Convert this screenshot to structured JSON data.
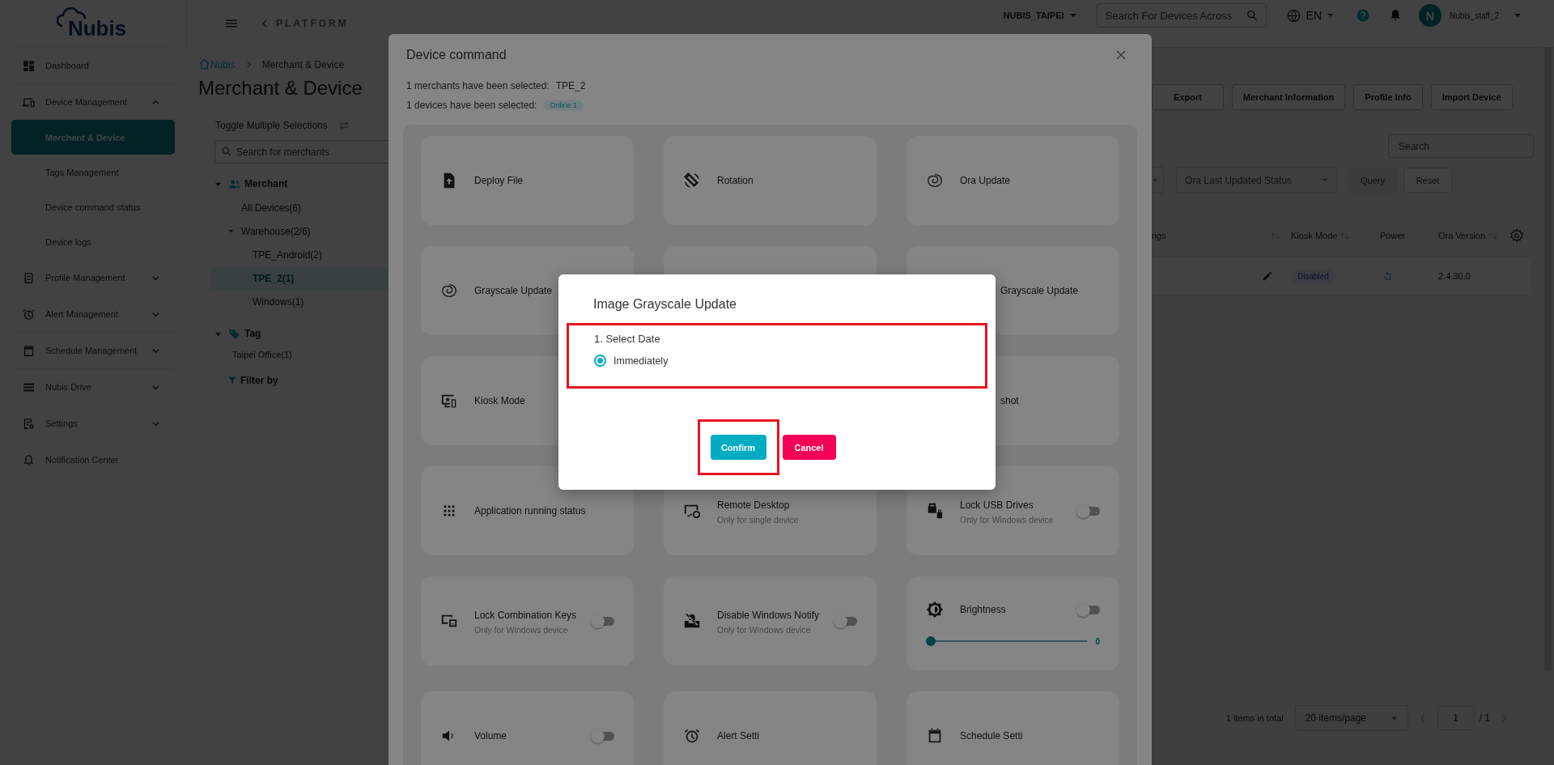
{
  "sidebar": {
    "logo": "Nubis",
    "items": [
      {
        "label": "Dashboard"
      },
      {
        "label": "Device Management",
        "expanded": true,
        "children": [
          {
            "label": "Merchant & Device",
            "selected": true
          },
          {
            "label": "Tags Management",
            "selected": false
          },
          {
            "label": "Device command status",
            "selected": false
          },
          {
            "label": "Device logs",
            "selected": false
          }
        ]
      },
      {
        "label": "Profile Management",
        "expanded": false
      },
      {
        "label": "Alert Management",
        "expanded": false
      },
      {
        "label": "Schedule Management",
        "expanded": false
      },
      {
        "label": "Nubis Drive",
        "expanded": false
      },
      {
        "label": "Settings",
        "expanded": false
      },
      {
        "label": "Notification Center"
      }
    ]
  },
  "topbar": {
    "back_label": "PLATFORM",
    "organization": "NUBIS_TAIPEI",
    "search_placeholder": "Search For Devices Across",
    "language": "EN",
    "user_initial": "N",
    "user_name": "Nubis_staff_2"
  },
  "page": {
    "breadcrumb": [
      "Nubis",
      "Merchant & Device"
    ],
    "title": "Merchant & Device"
  },
  "tree_panel": {
    "toggle_label": "Toggle Multiple Selections",
    "search_placeholder": "Search for merchants",
    "sections": [
      {
        "kind": "merchant",
        "label": "Merchant",
        "expanded": true,
        "nodes": [
          {
            "label": "All Devices(6)",
            "selected": false
          },
          {
            "label": "Warehouse(2/6)",
            "selected": false,
            "expanded": true,
            "children": [
              {
                "label": "TPE_Android(2)",
                "selected": false
              },
              {
                "label": "TPE_2(1)",
                "selected": true
              },
              {
                "label": "Windows(1)",
                "selected": false
              }
            ]
          }
        ]
      },
      {
        "kind": "tag",
        "label": "Tag",
        "expanded": true,
        "nodes": [
          {
            "label": "Taipei Office(1)",
            "selected": false
          }
        ]
      }
    ],
    "filter_label": "Filter by"
  },
  "devices_panel": {
    "actions": [
      "Export",
      "Merchant Information",
      "Profile Info",
      "Import Device"
    ],
    "search_placeholder": "Search",
    "filter_select": "Ora Last Updated Status",
    "query_button": "Query",
    "reset_button": "Reset",
    "table": {
      "columns": [
        {
          "label": "ngs"
        },
        {
          "label": "Kiosk Mode"
        },
        {
          "label": "Power"
        },
        {
          "label": "Ora Version"
        }
      ],
      "rows": [
        {
          "kiosk_mode": "Disabled",
          "ora_version": "2.4.30.0"
        }
      ]
    },
    "pagination": {
      "total": "1 items in total",
      "page_size": "20 items/page",
      "page": "1",
      "pages": "/ 1"
    }
  },
  "modal": {
    "title": "Device command",
    "merchants_label": "1 merchants have been selected:",
    "merchants_value": "TPE_2",
    "devices_label": "1 devices have been selected:",
    "devices_badge": "Online 1",
    "commands": [
      {
        "kind": "plain",
        "title": "Deploy File"
      },
      {
        "kind": "plain",
        "title": "Rotation"
      },
      {
        "kind": "plain",
        "title": "Ora Update"
      },
      {
        "kind": "plain",
        "title": "Grayscale Update"
      },
      {
        "kind": "cut",
        "title": "Grayscale Update"
      },
      {
        "kind": "plain",
        "title": "Kiosk Mode"
      },
      {
        "kind": "cut",
        "title": "shot"
      },
      {
        "kind": "plain",
        "title": "Application running status"
      },
      {
        "kind": "plain",
        "title": "Remote Desktop",
        "subtitle": "Only for single device"
      },
      {
        "kind": "toggle",
        "title": "Lock USB Drives",
        "subtitle": "Only for Windows device",
        "on": false
      },
      {
        "kind": "toggle",
        "title": "Lock Combination Keys",
        "subtitle": "Only for Windows device",
        "on": false
      },
      {
        "kind": "toggle",
        "title": "Disable Windows Notify",
        "subtitle": "Only for Windows device",
        "on": false
      },
      {
        "kind": "slider",
        "title": "Brightness",
        "on": false,
        "level": 0,
        "reading": "0"
      },
      {
        "kind": "toggle",
        "title": "Volume",
        "on": false
      },
      {
        "kind": "plain",
        "title": "Alert Setti"
      },
      {
        "kind": "plain",
        "title": "Schedule Setti"
      }
    ]
  },
  "dialog": {
    "title": "Image Grayscale Update",
    "step_label": "1. Select Date",
    "step_highlighted": true,
    "options": [
      {
        "label": "Immediately",
        "selected": true
      }
    ],
    "confirm": {
      "label": "Confirm",
      "highlighted": true
    },
    "cancel": "Cancel"
  }
}
